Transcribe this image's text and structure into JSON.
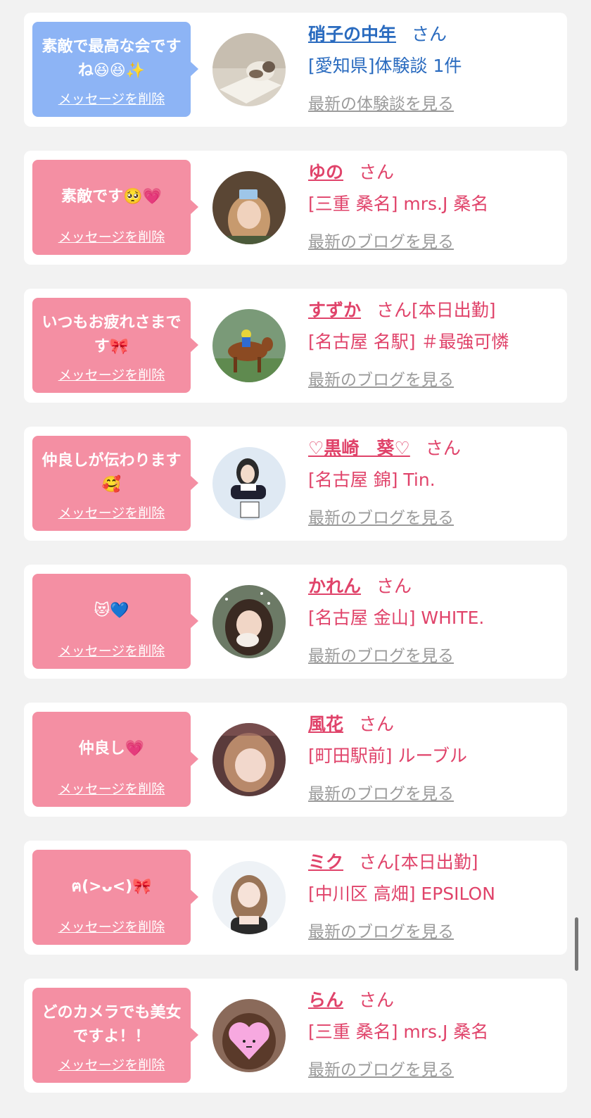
{
  "accent_pink": "#e0436a",
  "bubble_pink": "#f48fa3",
  "bubble_blue": "#8db4f5",
  "link_blue": "#2a6bbf",
  "entries": [
    {
      "message": "素敵で最高な会ですね😆😆✨",
      "delete_label": "メッセージを削除",
      "name": "硝子の中年",
      "honorific": "さん",
      "status": "",
      "shop": "[愛知県]体験談 1件",
      "latest_label": "最新の体験談を見る",
      "bubble_color": "blue",
      "avatar_icon": "cat-photo"
    },
    {
      "message": "素敵です🥺💗",
      "delete_label": "メッセージを削除",
      "name": "ゆの",
      "honorific": "さん",
      "status": "",
      "shop": "[三重 桑名] mrs.J 桑名",
      "latest_label": "最新のブログを見る",
      "bubble_color": "pink",
      "avatar_icon": "person-photo"
    },
    {
      "message": "いつもお疲れさまです🎀",
      "delete_label": "メッセージを削除",
      "name": "すずか",
      "honorific": "さん",
      "status": "[本日出勤]",
      "shop": "[名古屋 名駅] ＃最強可憐",
      "latest_label": "最新のブログを見る",
      "bubble_color": "pink",
      "avatar_icon": "horse-race-photo"
    },
    {
      "message": "仲良しが伝わります🥰",
      "delete_label": "メッセージを削除",
      "name": "♡黒崎　葵♡",
      "honorific": "さん",
      "status": "",
      "shop": "[名古屋 錦] Tin.",
      "latest_label": "最新のブログを見る",
      "bubble_color": "pink",
      "avatar_icon": "snow-person-photo"
    },
    {
      "message": "😻💙",
      "delete_label": "メッセージを削除",
      "name": "かれん",
      "honorific": "さん",
      "status": "",
      "shop": "[名古屋 金山] WHITE.",
      "latest_label": "最新のブログを見る",
      "bubble_color": "pink",
      "avatar_icon": "person-photo"
    },
    {
      "message": "仲良し💗",
      "delete_label": "メッセージを削除",
      "name": "風花",
      "honorific": "さん",
      "status": "",
      "shop": "[町田駅前] ルーブル",
      "latest_label": "最新のブログを見る",
      "bubble_color": "pink",
      "avatar_icon": "person-photo"
    },
    {
      "message": "ฅ(>ᴗ<)🎀",
      "delete_label": "メッセージを削除",
      "name": "ミク",
      "honorific": "さん",
      "status": "[本日出勤]",
      "shop": "[中川区 高畑] EPSILON",
      "latest_label": "最新のブログを見る",
      "bubble_color": "pink",
      "avatar_icon": "person-photo"
    },
    {
      "message": "どのカメラでも美女ですよ！！",
      "delete_label": "メッセージを削除",
      "name": "らん",
      "honorific": "さん",
      "status": "",
      "shop": "[三重 桑名] mrs.J 桑名",
      "latest_label": "最新のブログを見る",
      "bubble_color": "pink",
      "avatar_icon": "heart-face-photo"
    }
  ]
}
